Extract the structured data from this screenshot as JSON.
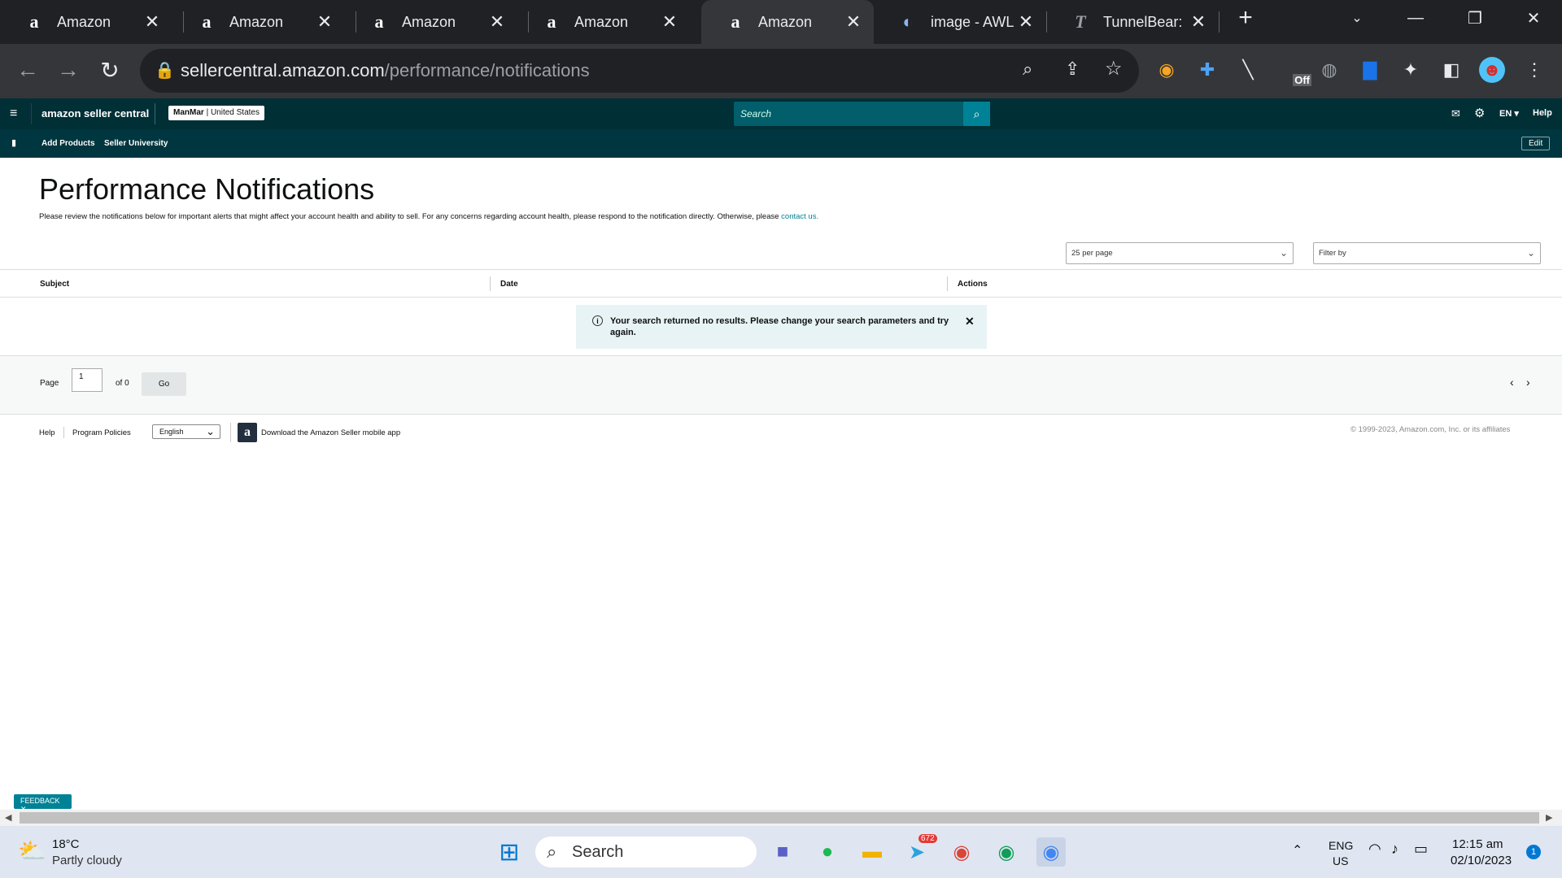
{
  "browser": {
    "tabs": [
      {
        "title": "Amazon",
        "icon": "amazon-icon"
      },
      {
        "title": "Amazon",
        "icon": "amazon-icon"
      },
      {
        "title": "Amazon",
        "icon": "amazon-icon"
      },
      {
        "title": "Amazon",
        "icon": "amazon-icon"
      },
      {
        "title": "Amazon",
        "icon": "amazon-icon"
      },
      {
        "title": "image - AWL",
        "icon": "edge-icon"
      },
      {
        "title": "TunnelBear: S",
        "icon": "tunnelbear-icon"
      }
    ],
    "active_tab_index": 4,
    "url_host": "sellercentral.amazon.com",
    "url_path": "/performance/notifications",
    "extension_badge": "Off"
  },
  "header": {
    "logo": "amazon seller central",
    "account_name": "ManMar",
    "account_region": "United States",
    "search_placeholder": "Search",
    "language": "EN",
    "help": "Help"
  },
  "nav": {
    "links": [
      "Add Products",
      "Seller University"
    ],
    "edit": "Edit"
  },
  "page": {
    "title": "Performance Notifications",
    "intro": "Please review the notifications below for important alerts that might affect your account health and ability to sell. For any concerns regarding account health, please respond to the notification directly. Otherwise, please ",
    "contact_link": "contact us.",
    "per_page": "25 per page",
    "filter_placeholder": "Filter by",
    "columns": [
      "Subject",
      "Date",
      "Actions"
    ],
    "alert_message": "Your search returned no results. Please change your search parameters and try again.",
    "pager": {
      "page_label": "Page",
      "page_value": "1",
      "of_label": "of 0",
      "go": "Go"
    }
  },
  "footer": {
    "links": [
      "Help",
      "Program Policies"
    ],
    "language": "English",
    "app_text": "Download the Amazon Seller mobile app",
    "copyright": "© 1999-2023, Amazon.com, Inc. or its affiliates"
  },
  "feedback": "FEEDBACK",
  "taskbar": {
    "weather_temp": "18°C",
    "weather_desc": "Partly cloudy",
    "search": "Search",
    "telegram_badge": "672",
    "lang_top": "ENG",
    "lang_bottom": "US",
    "time": "12:15 am",
    "date": "02/10/2023",
    "notification_count": "1"
  },
  "colors": {
    "header_bg": "#002f36",
    "accent": "#008296",
    "chrome_dark": "#202124"
  }
}
